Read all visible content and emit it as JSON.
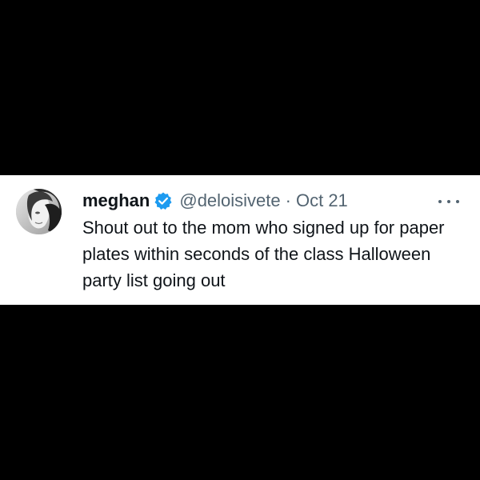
{
  "tweet": {
    "author": {
      "name": "meghan",
      "handle": "@deloisivete",
      "verified": true
    },
    "separator": "·",
    "date": "Oct 21",
    "text": "Shout out to the mom who signed up for paper plates within seconds of the class Halloween party list going out",
    "more_icon": "more-horizontal-icon",
    "verified_icon": "verified-badge-icon"
  },
  "colors": {
    "page_background": "#000000",
    "card_background": "#ffffff",
    "text_primary": "#0f1419",
    "text_secondary": "#536471",
    "verified_blue": "#1d9bf0"
  }
}
